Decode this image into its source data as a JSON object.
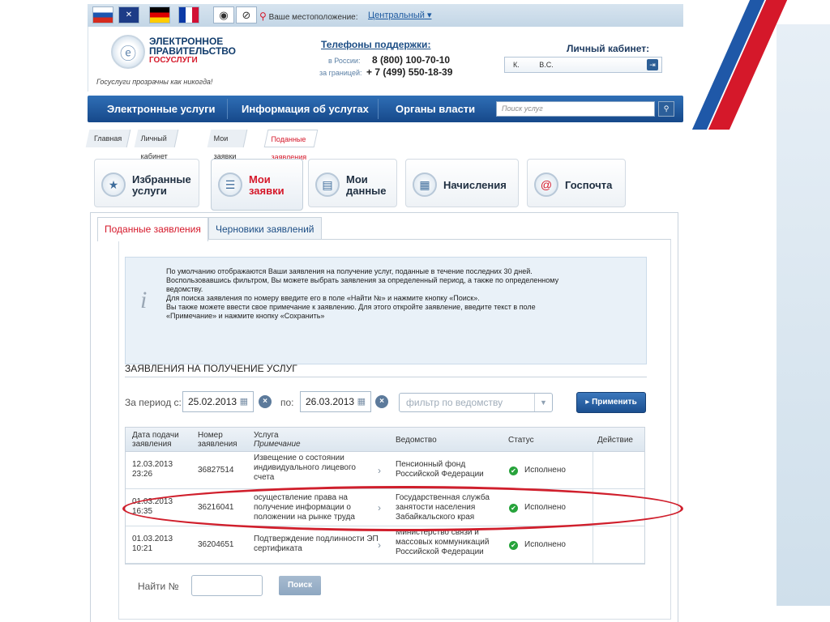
{
  "topbar": {
    "flags": [
      "ru",
      "uk",
      "de",
      "fr"
    ],
    "location_label": "Ваше местоположение:",
    "location_value": "Центральный"
  },
  "logo": {
    "line1": "ЭЛЕКТРОННОЕ",
    "line2": "ПРАВИТЕЛЬСТВО",
    "line3": "ГОСУСЛУГИ",
    "slogan": "Госуслуги прозрачны как никогда!"
  },
  "support": {
    "title": "Телефоны поддержки:",
    "russia_label": "в России:",
    "russia_number": "8 (800) 100-70-10",
    "abroad_label": "за границей:",
    "abroad_number": "+ 7 (499) 550-18-39"
  },
  "cabinet": {
    "title": "Личный кабинет:",
    "user_initial": "К.",
    "user_name": "В.С."
  },
  "nav": {
    "items": [
      "Электронные услуги",
      "Информация об услугах",
      "Органы власти"
    ],
    "search_placeholder": "Поиск услуг"
  },
  "breadcrumbs": [
    "Главная",
    "Личный кабинет",
    "Мои заявки",
    "Поданные заявления"
  ],
  "main_tabs": [
    {
      "line1": "Избранные",
      "line2": "услуги",
      "icon": "star-icon"
    },
    {
      "line1": "Мои",
      "line2": "заявки",
      "icon": "list-icon"
    },
    {
      "line1": "Мои",
      "line2": "данные",
      "icon": "id-card-icon"
    },
    {
      "line1": "Начисления",
      "line2": "",
      "icon": "calculator-icon"
    },
    {
      "line1": "Госпочта",
      "line2": "",
      "icon": "mail-at-icon"
    }
  ],
  "sub_tabs": [
    "Поданные заявления",
    "Черновики заявлений"
  ],
  "info_lines": [
    "По умолчанию отображаются Ваши заявления на получение услуг, поданные в течение последних 30 дней.",
    "Воспользовавшись фильтром, Вы можете выбрать заявления за определенный период, а также по определенному",
    "ведомству.",
    "Для поиска заявления по номеру введите его в поле «Найти №» и  нажмите кнопку «Поиск».",
    "Вы также можете ввести свое примечание к заявлению. Для этого откройте заявление, введите текст в поле",
    "«Примечание» и  нажмите кнопку «Сохранить»"
  ],
  "section_title": "ЗАЯВЛЕНИЯ НА ПОЛУЧЕНИЕ УСЛУГ",
  "filter": {
    "period_from_label": "За период с:",
    "date_from": "25.02.2013",
    "period_to_label": "по:",
    "date_to": "26.03.2013",
    "agency_placeholder": "фильтр по ведомству",
    "apply_label": "Применить"
  },
  "table": {
    "headers": {
      "date_l1": "Дата подачи",
      "date_l2": "заявления",
      "num_l1": "Номер",
      "num_l2": "заявления",
      "service_l1": "Услуга",
      "service_l2": "Примечание",
      "agency": "Ведомство",
      "status": "Статус",
      "action": "Действие"
    },
    "rows": [
      {
        "date": "12.03.2013",
        "time": "23:26",
        "number": "36827514",
        "service": [
          "Извещение о состоянии",
          "индивидуального лицевого",
          "счета"
        ],
        "agency": [
          "Пенсионный фонд",
          "Российской Федерации"
        ],
        "status": "Исполнено"
      },
      {
        "date": "01.03.2013",
        "time": "16:35",
        "number": "36216041",
        "service": [
          "осуществление права на",
          "получение информации о",
          "положении на рынке труда"
        ],
        "agency": [
          "Государственная служба",
          "занятости населения",
          "Забайкальского края"
        ],
        "status": "Исполнено"
      },
      {
        "date": "01.03.2013",
        "time": "10:21",
        "number": "36204651",
        "service": [
          "Подтверждение подлинности ЭП",
          "сертификата"
        ],
        "agency": [
          "Министерство связи и",
          "массовых коммуникаций",
          "Российской Федерации"
        ],
        "status": "Исполнено"
      }
    ]
  },
  "search_number": {
    "label": "Найти №",
    "button": "Поиск"
  },
  "colors": {
    "brand_blue": "#16488a",
    "accent_red": "#d5182a",
    "status_green": "#27a33b",
    "highlight_red": "#d01f2c"
  }
}
